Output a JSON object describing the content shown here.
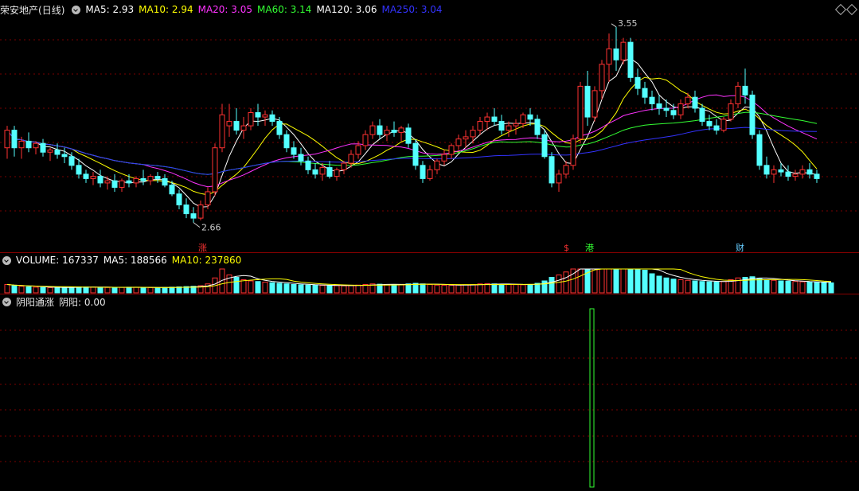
{
  "main_panel": {
    "stock_name": "荣安地产",
    "period": "(日线)",
    "indicators": [
      {
        "label": "MA5: ",
        "value": "2.93",
        "color": "#ffffff"
      },
      {
        "label": "MA10: ",
        "value": "2.94",
        "color": "#ffff00"
      },
      {
        "label": "MA20: ",
        "value": "3.05",
        "color": "#ff33ff"
      },
      {
        "label": "MA60: ",
        "value": "3.14",
        "color": "#33ff33"
      },
      {
        "label": "MA120: ",
        "value": "3.06",
        "color": "#ffffff"
      },
      {
        "label": "MA250: ",
        "value": "3.04",
        "color": "#3333ff"
      }
    ],
    "high_marker": "3.55",
    "low_marker": "2.66",
    "event_tags": [
      {
        "text": "涨",
        "color": "#ff3333"
      },
      {
        "text": "$",
        "color": "#ff3333"
      },
      {
        "text": "港",
        "color": "#33ff33"
      },
      {
        "text": "财",
        "color": "#66ccff"
      }
    ]
  },
  "volume_panel": {
    "volume_label": "VOLUME: ",
    "volume_value": "167337",
    "ma5_label": "MA5: ",
    "ma5_value": "188566",
    "ma10_label": "MA10: ",
    "ma10_value": "237860"
  },
  "indicator_panel": {
    "name": "阴阳通涨",
    "value_label": "阴阳: ",
    "value": "0.00"
  },
  "colors": {
    "up": "#ff3232",
    "down": "#54ffff",
    "grid": "#7a0000",
    "ma5": "#ffffff",
    "ma10": "#ffff00",
    "ma20": "#ff33ff",
    "ma60": "#33ff33",
    "ma250": "#3333ff"
  },
  "chart_data": {
    "type": "candlestick",
    "y_range_main": [
      2.55,
      3.6
    ],
    "candles": [
      [
        3.0,
        3.1,
        2.95,
        3.08
      ],
      [
        3.08,
        3.1,
        2.96,
        3.0
      ],
      [
        3.0,
        3.05,
        2.95,
        3.03
      ],
      [
        3.03,
        3.07,
        2.98,
        3.0
      ],
      [
        3.0,
        3.03,
        2.97,
        3.02
      ],
      [
        3.02,
        3.04,
        2.96,
        2.98
      ],
      [
        2.98,
        3.0,
        2.94,
        2.99
      ],
      [
        2.99,
        3.02,
        2.95,
        2.97
      ],
      [
        2.97,
        3.0,
        2.93,
        2.96
      ],
      [
        2.96,
        2.98,
        2.9,
        2.92
      ],
      [
        2.92,
        2.95,
        2.86,
        2.88
      ],
      [
        2.88,
        2.9,
        2.84,
        2.86
      ],
      [
        2.86,
        2.89,
        2.83,
        2.87
      ],
      [
        2.87,
        2.9,
        2.82,
        2.84
      ],
      [
        2.84,
        2.87,
        2.81,
        2.85
      ],
      [
        2.85,
        2.88,
        2.8,
        2.82
      ],
      [
        2.82,
        2.86,
        2.8,
        2.85
      ],
      [
        2.85,
        2.88,
        2.82,
        2.84
      ],
      [
        2.84,
        2.87,
        2.82,
        2.86
      ],
      [
        2.86,
        2.9,
        2.83,
        2.85
      ],
      [
        2.85,
        2.88,
        2.83,
        2.87
      ],
      [
        2.87,
        2.89,
        2.84,
        2.86
      ],
      [
        2.86,
        2.88,
        2.82,
        2.83
      ],
      [
        2.83,
        2.85,
        2.78,
        2.79
      ],
      [
        2.79,
        2.81,
        2.72,
        2.74
      ],
      [
        2.74,
        2.77,
        2.68,
        2.7
      ],
      [
        2.7,
        2.73,
        2.66,
        2.68
      ],
      [
        2.68,
        2.76,
        2.67,
        2.74
      ],
      [
        2.74,
        2.82,
        2.72,
        2.8
      ],
      [
        2.8,
        3.02,
        2.78,
        3.0
      ],
      [
        3.0,
        3.2,
        2.98,
        3.15
      ],
      [
        3.1,
        3.2,
        3.05,
        3.12
      ],
      [
        3.12,
        3.18,
        3.06,
        3.08
      ],
      [
        3.08,
        3.14,
        3.04,
        3.1
      ],
      [
        3.1,
        3.18,
        3.08,
        3.16
      ],
      [
        3.16,
        3.2,
        3.1,
        3.14
      ],
      [
        3.14,
        3.17,
        3.1,
        3.15
      ],
      [
        3.15,
        3.17,
        3.1,
        3.12
      ],
      [
        3.12,
        3.14,
        3.04,
        3.06
      ],
      [
        3.06,
        3.08,
        2.98,
        3.0
      ],
      [
        3.0,
        3.03,
        2.95,
        2.97
      ],
      [
        2.97,
        3.0,
        2.92,
        2.94
      ],
      [
        2.94,
        2.96,
        2.88,
        2.9
      ],
      [
        2.9,
        2.93,
        2.86,
        2.88
      ],
      [
        2.88,
        2.93,
        2.85,
        2.91
      ],
      [
        2.91,
        2.94,
        2.86,
        2.87
      ],
      [
        2.87,
        2.91,
        2.85,
        2.9
      ],
      [
        2.9,
        2.94,
        2.88,
        2.93
      ],
      [
        2.93,
        2.99,
        2.91,
        2.97
      ],
      [
        2.97,
        3.03,
        2.95,
        3.01
      ],
      [
        3.01,
        3.08,
        2.99,
        3.06
      ],
      [
        3.06,
        3.12,
        3.04,
        3.1
      ],
      [
        3.1,
        3.13,
        3.04,
        3.06
      ],
      [
        3.06,
        3.1,
        3.03,
        3.08
      ],
      [
        3.08,
        3.12,
        3.05,
        3.07
      ],
      [
        3.07,
        3.1,
        3.03,
        3.09
      ],
      [
        3.09,
        3.11,
        3.0,
        3.02
      ],
      [
        3.02,
        3.04,
        2.9,
        2.92
      ],
      [
        2.92,
        2.94,
        2.84,
        2.86
      ],
      [
        2.86,
        2.92,
        2.85,
        2.9
      ],
      [
        2.9,
        2.95,
        2.88,
        2.94
      ],
      [
        2.94,
        2.99,
        2.92,
        2.97
      ],
      [
        2.97,
        3.02,
        2.95,
        3.01
      ],
      [
        3.01,
        3.06,
        2.99,
        3.04
      ],
      [
        3.04,
        3.08,
        3.0,
        3.05
      ],
      [
        3.05,
        3.1,
        3.02,
        3.08
      ],
      [
        3.08,
        3.14,
        3.06,
        3.12
      ],
      [
        3.12,
        3.16,
        3.08,
        3.14
      ],
      [
        3.14,
        3.18,
        3.1,
        3.12
      ],
      [
        3.12,
        3.15,
        3.06,
        3.08
      ],
      [
        3.08,
        3.12,
        3.05,
        3.1
      ],
      [
        3.1,
        3.13,
        3.06,
        3.11
      ],
      [
        3.11,
        3.16,
        3.09,
        3.15
      ],
      [
        3.15,
        3.18,
        3.1,
        3.13
      ],
      [
        3.13,
        3.15,
        3.04,
        3.06
      ],
      [
        3.06,
        3.08,
        2.95,
        2.96
      ],
      [
        2.96,
        2.98,
        2.82,
        2.84
      ],
      [
        2.84,
        2.9,
        2.8,
        2.88
      ],
      [
        2.88,
        2.94,
        2.86,
        2.92
      ],
      [
        2.92,
        3.06,
        2.9,
        3.04
      ],
      [
        3.04,
        3.3,
        3.02,
        3.28
      ],
      [
        3.28,
        3.35,
        3.1,
        3.14
      ],
      [
        3.14,
        3.28,
        3.12,
        3.26
      ],
      [
        3.26,
        3.4,
        3.22,
        3.38
      ],
      [
        3.38,
        3.52,
        3.3,
        3.45
      ],
      [
        3.45,
        3.55,
        3.35,
        3.4
      ],
      [
        3.4,
        3.5,
        3.38,
        3.48
      ],
      [
        3.48,
        3.5,
        3.3,
        3.32
      ],
      [
        3.32,
        3.36,
        3.24,
        3.27
      ],
      [
        3.27,
        3.3,
        3.2,
        3.23
      ],
      [
        3.23,
        3.26,
        3.17,
        3.2
      ],
      [
        3.2,
        3.24,
        3.15,
        3.18
      ],
      [
        3.18,
        3.22,
        3.14,
        3.17
      ],
      [
        3.17,
        3.2,
        3.13,
        3.15
      ],
      [
        3.15,
        3.22,
        3.13,
        3.2
      ],
      [
        3.2,
        3.25,
        3.18,
        3.23
      ],
      [
        3.23,
        3.26,
        3.16,
        3.18
      ],
      [
        3.18,
        3.2,
        3.1,
        3.12
      ],
      [
        3.12,
        3.15,
        3.08,
        3.1
      ],
      [
        3.1,
        3.13,
        3.06,
        3.08
      ],
      [
        3.08,
        3.14,
        3.07,
        3.13
      ],
      [
        3.13,
        3.22,
        3.12,
        3.2
      ],
      [
        3.2,
        3.3,
        3.18,
        3.28
      ],
      [
        3.28,
        3.36,
        3.2,
        3.24
      ],
      [
        3.24,
        3.26,
        3.04,
        3.06
      ],
      [
        3.06,
        3.08,
        2.9,
        2.92
      ],
      [
        2.92,
        2.96,
        2.86,
        2.88
      ],
      [
        2.88,
        2.92,
        2.84,
        2.9
      ],
      [
        2.9,
        2.93,
        2.87,
        2.89
      ],
      [
        2.89,
        2.92,
        2.85,
        2.87
      ],
      [
        2.87,
        2.9,
        2.85,
        2.88
      ],
      [
        2.88,
        2.92,
        2.86,
        2.9
      ],
      [
        2.9,
        2.93,
        2.86,
        2.88
      ],
      [
        2.88,
        2.9,
        2.84,
        2.86
      ]
    ],
    "volume_range": [
      0,
      400000
    ],
    "volumes": [
      140000,
      120000,
      110000,
      100000,
      95000,
      90000,
      88000,
      92000,
      90000,
      95000,
      100000,
      98000,
      96000,
      94000,
      90000,
      88000,
      92000,
      95000,
      93000,
      90000,
      88000,
      86000,
      90000,
      95000,
      100000,
      105000,
      110000,
      120000,
      150000,
      250000,
      420000,
      300000,
      260000,
      220000,
      200000,
      190000,
      180000,
      170000,
      160000,
      150000,
      140000,
      135000,
      130000,
      128000,
      125000,
      122000,
      120000,
      118000,
      122000,
      130000,
      140000,
      150000,
      145000,
      140000,
      138000,
      135000,
      150000,
      160000,
      150000,
      140000,
      130000,
      128000,
      125000,
      130000,
      135000,
      140000,
      150000,
      155000,
      150000,
      145000,
      140000,
      138000,
      135000,
      140000,
      160000,
      200000,
      260000,
      300000,
      350000,
      480000,
      650000,
      700000,
      620000,
      680000,
      720000,
      700000,
      600000,
      520000,
      420000,
      380000,
      320000,
      280000,
      250000,
      230000,
      220000,
      210000,
      200000,
      190000,
      185000,
      180000,
      190000,
      220000,
      250000,
      260000,
      270000,
      240000,
      220000,
      210000,
      200000,
      195000,
      190000,
      185000,
      180000,
      175000,
      170000,
      167337
    ],
    "indicator_spike_index": 79,
    "indicator_range": [
      0,
      1
    ],
    "indicator_spike_value": 1
  }
}
